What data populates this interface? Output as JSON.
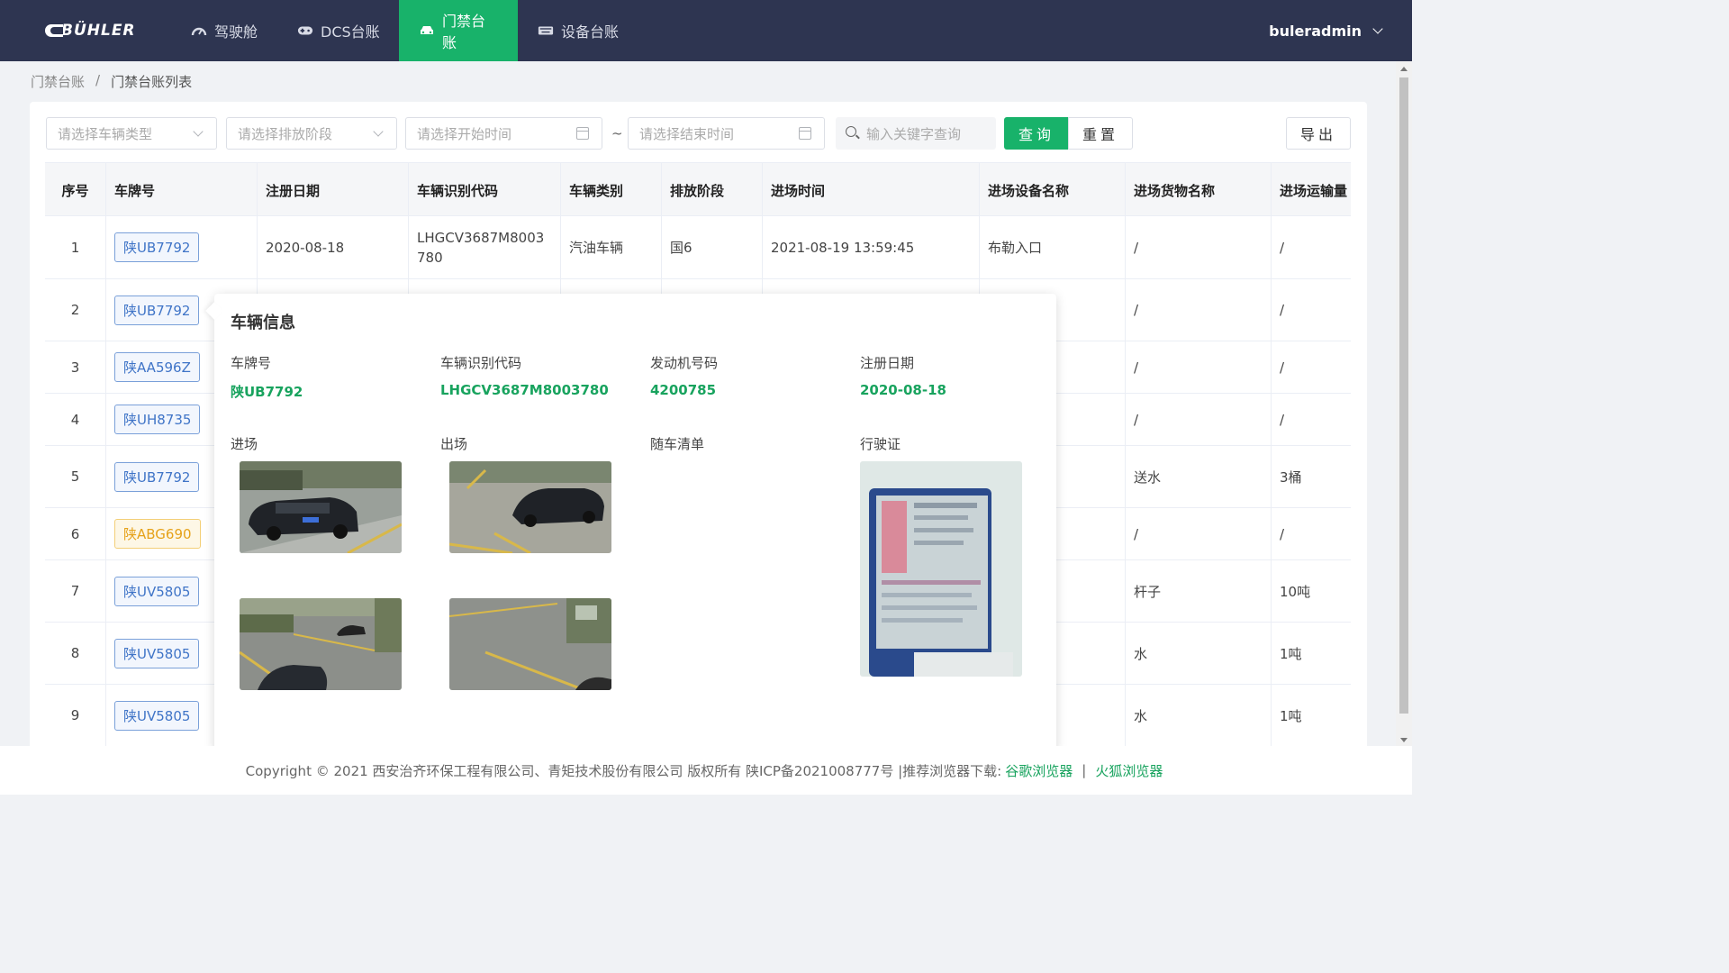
{
  "app": {
    "logo_text": "BÜHLER",
    "nav": [
      {
        "label": "驾驶舱",
        "icon": "dashboard-icon",
        "active": false
      },
      {
        "label": "DCS台账",
        "icon": "gamepad-icon",
        "active": false
      },
      {
        "label": "门禁台账",
        "icon": "car-icon",
        "active": true
      },
      {
        "label": "设备台账",
        "icon": "keyboard-icon",
        "active": false
      }
    ],
    "user": "buleradmin"
  },
  "breadcrumb": {
    "parent": "门禁台账",
    "separator": "/",
    "current": "门禁台账列表"
  },
  "filters": {
    "vehicle_type_placeholder": "请选择车辆类型",
    "emission_stage_placeholder": "请选择排放阶段",
    "start_time_placeholder": "请选择开始时间",
    "range_separator": "~",
    "end_time_placeholder": "请选择结束时间",
    "keyword_placeholder": "输入关键字查询",
    "query_label": "查询",
    "reset_label": "重置",
    "export_label": "导出"
  },
  "table": {
    "headers": [
      "序号",
      "车牌号",
      "注册日期",
      "车辆识别代码",
      "车辆类别",
      "排放阶段",
      "进场时间",
      "进场设备名称",
      "进场货物名称",
      "进场运输量"
    ],
    "rows": [
      {
        "no": "1",
        "plate": "陕UB7792",
        "plate_color": "blue",
        "reg_date": "2020-08-18",
        "vin": "LHGCV3687M8003780",
        "category": "汽油车辆",
        "stage": "国6",
        "entry_time": "2021-08-19 13:59:45",
        "device": "布勒入口",
        "cargo": "/",
        "amount": "/"
      },
      {
        "no": "2",
        "plate": "陕UB7792",
        "plate_color": "blue",
        "reg_date": "",
        "vin": "",
        "category": "",
        "stage": "",
        "entry_time": "",
        "device": "",
        "cargo": "/",
        "amount": "/"
      },
      {
        "no": "3",
        "plate": "陕AA596Z",
        "plate_color": "blue",
        "reg_date": "",
        "vin": "",
        "category": "",
        "stage": "",
        "entry_time": "",
        "device": "",
        "cargo": "/",
        "amount": "/"
      },
      {
        "no": "4",
        "plate": "陕UH8735",
        "plate_color": "blue",
        "reg_date": "",
        "vin": "",
        "category": "",
        "stage": "",
        "entry_time": "",
        "device": "",
        "cargo": "/",
        "amount": "/"
      },
      {
        "no": "5",
        "plate": "陕UB7792",
        "plate_color": "blue",
        "reg_date": "",
        "vin": "",
        "category": "",
        "stage": "",
        "entry_time": "",
        "device": "",
        "cargo": "送水",
        "amount": "3桶"
      },
      {
        "no": "6",
        "plate": "陕ABG690",
        "plate_color": "yellow",
        "reg_date": "",
        "vin": "",
        "category": "",
        "stage": "",
        "entry_time": "",
        "device": "",
        "cargo": "/",
        "amount": "/"
      },
      {
        "no": "7",
        "plate": "陕UV5805",
        "plate_color": "blue",
        "reg_date": "",
        "vin": "",
        "category": "",
        "stage": "",
        "entry_time": "",
        "device": "",
        "cargo": "杆子",
        "amount": "10吨"
      },
      {
        "no": "8",
        "plate": "陕UV5805",
        "plate_color": "blue",
        "reg_date": "",
        "vin": "",
        "category": "",
        "stage": "",
        "entry_time": "",
        "device": "",
        "cargo": "水",
        "amount": "1吨"
      },
      {
        "no": "9",
        "plate": "陕UV5805",
        "plate_color": "blue",
        "reg_date": "",
        "vin": "",
        "category": "",
        "stage": "",
        "entry_time": "",
        "device": "",
        "cargo": "水",
        "amount": "1吨"
      }
    ]
  },
  "popover": {
    "title": "车辆信息",
    "fields": [
      {
        "label": "车牌号",
        "value": "陕UB7792"
      },
      {
        "label": "车辆识别代码",
        "value": "LHGCV3687M8003780"
      },
      {
        "label": "发动机号码",
        "value": "4200785"
      },
      {
        "label": "注册日期",
        "value": "2020-08-18"
      }
    ],
    "sections": {
      "entry": "进场",
      "exit": "出场",
      "cargo_list": "随车清单",
      "license": "行驶证"
    }
  },
  "footer": {
    "text": "Copyright © 2021 西安治齐环保工程有限公司、青矩技术股份有限公司 版权所有  陕ICP备2021008777号  |推荐浏览器下载:",
    "browser1": "谷歌浏览器",
    "sep": "|",
    "browser2": "火狐浏览器"
  },
  "colors": {
    "header_bg": "#2e3551",
    "accent_green": "#18b26a",
    "plate_blue": "#3f74c7",
    "plate_yellow": "#e6a21a"
  }
}
